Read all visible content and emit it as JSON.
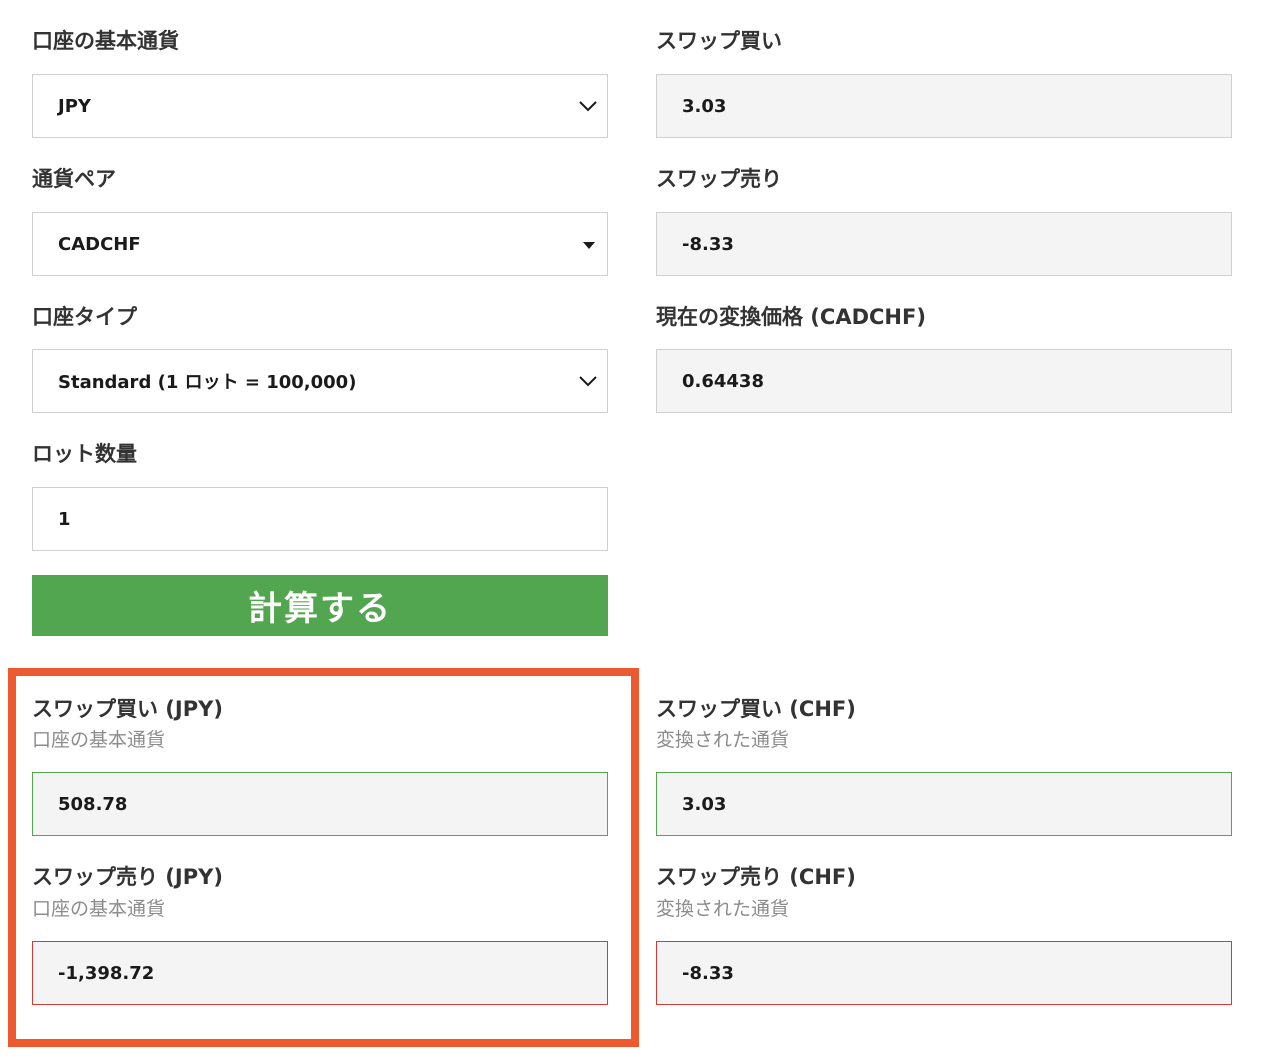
{
  "colors": {
    "button_bg": "#53a650",
    "button_text": "#ffffff",
    "highlight": "#ee5a2f",
    "positive_border": "#53a84f",
    "negative_border": "#d53a3a",
    "readonly_bg": "#f4f4f4"
  },
  "form": {
    "base_currency": {
      "label": "口座の基本通貨",
      "value": "JPY",
      "icon": "chevron-down-icon"
    },
    "currency_pair": {
      "label": "通貨ペア",
      "value": "CADCHF",
      "icon": "caret-down-icon"
    },
    "account_type": {
      "label": "口座タイプ",
      "value": "Standard (1 ロット = 100,000)",
      "icon": "chevron-down-icon"
    },
    "lot_size": {
      "label": "ロット数量",
      "value": "1"
    },
    "calculate_button": "計算する"
  },
  "rates": {
    "swap_buy": {
      "label": "スワップ買い",
      "value": "3.03"
    },
    "swap_sell": {
      "label": "スワップ売り",
      "value": "-8.33"
    },
    "conversion_price": {
      "label": "現在の変換価格 (CADCHF)",
      "value": "0.64438"
    }
  },
  "results": {
    "base": {
      "swap_buy": {
        "label": "スワップ買い (JPY)",
        "sublabel": "口座の基本通貨",
        "value": "508.78"
      },
      "swap_sell": {
        "label": "スワップ売り (JPY)",
        "sublabel": "口座の基本通貨",
        "value": "-1,398.72"
      }
    },
    "converted": {
      "swap_buy": {
        "label": "スワップ買い (CHF)",
        "sublabel": "変換された通貨",
        "value": "3.03"
      },
      "swap_sell": {
        "label": "スワップ売り (CHF)",
        "sublabel": "変換された通貨",
        "value": "-8.33"
      }
    }
  }
}
